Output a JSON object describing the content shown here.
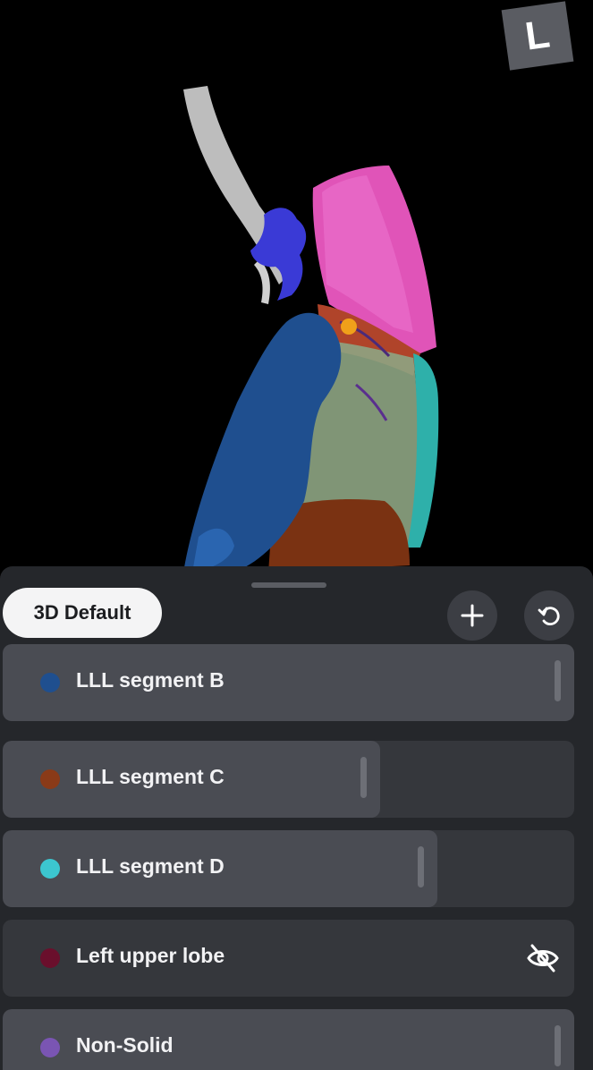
{
  "viewer": {
    "orientation_label": "L"
  },
  "panel": {
    "preset_label": "3D Default",
    "add_icon": "plus-icon",
    "reset_icon": "rotate-ccw-icon"
  },
  "segments": [
    {
      "label": "LLL segment B",
      "color": "#1f4f8f",
      "opacity": 1.0,
      "visible": true
    },
    {
      "label": "LLL segment C",
      "color": "#8a3a18",
      "opacity": 0.66,
      "visible": true
    },
    {
      "label": "LLL segment D",
      "color": "#3cc6cf",
      "opacity": 0.76,
      "visible": true
    },
    {
      "label": "Left upper lobe",
      "color": "#6a0f2c",
      "opacity": 0.0,
      "visible": false
    },
    {
      "label": "Non-Solid",
      "color": "#7a55b3",
      "opacity": 1.0,
      "visible": true
    }
  ]
}
